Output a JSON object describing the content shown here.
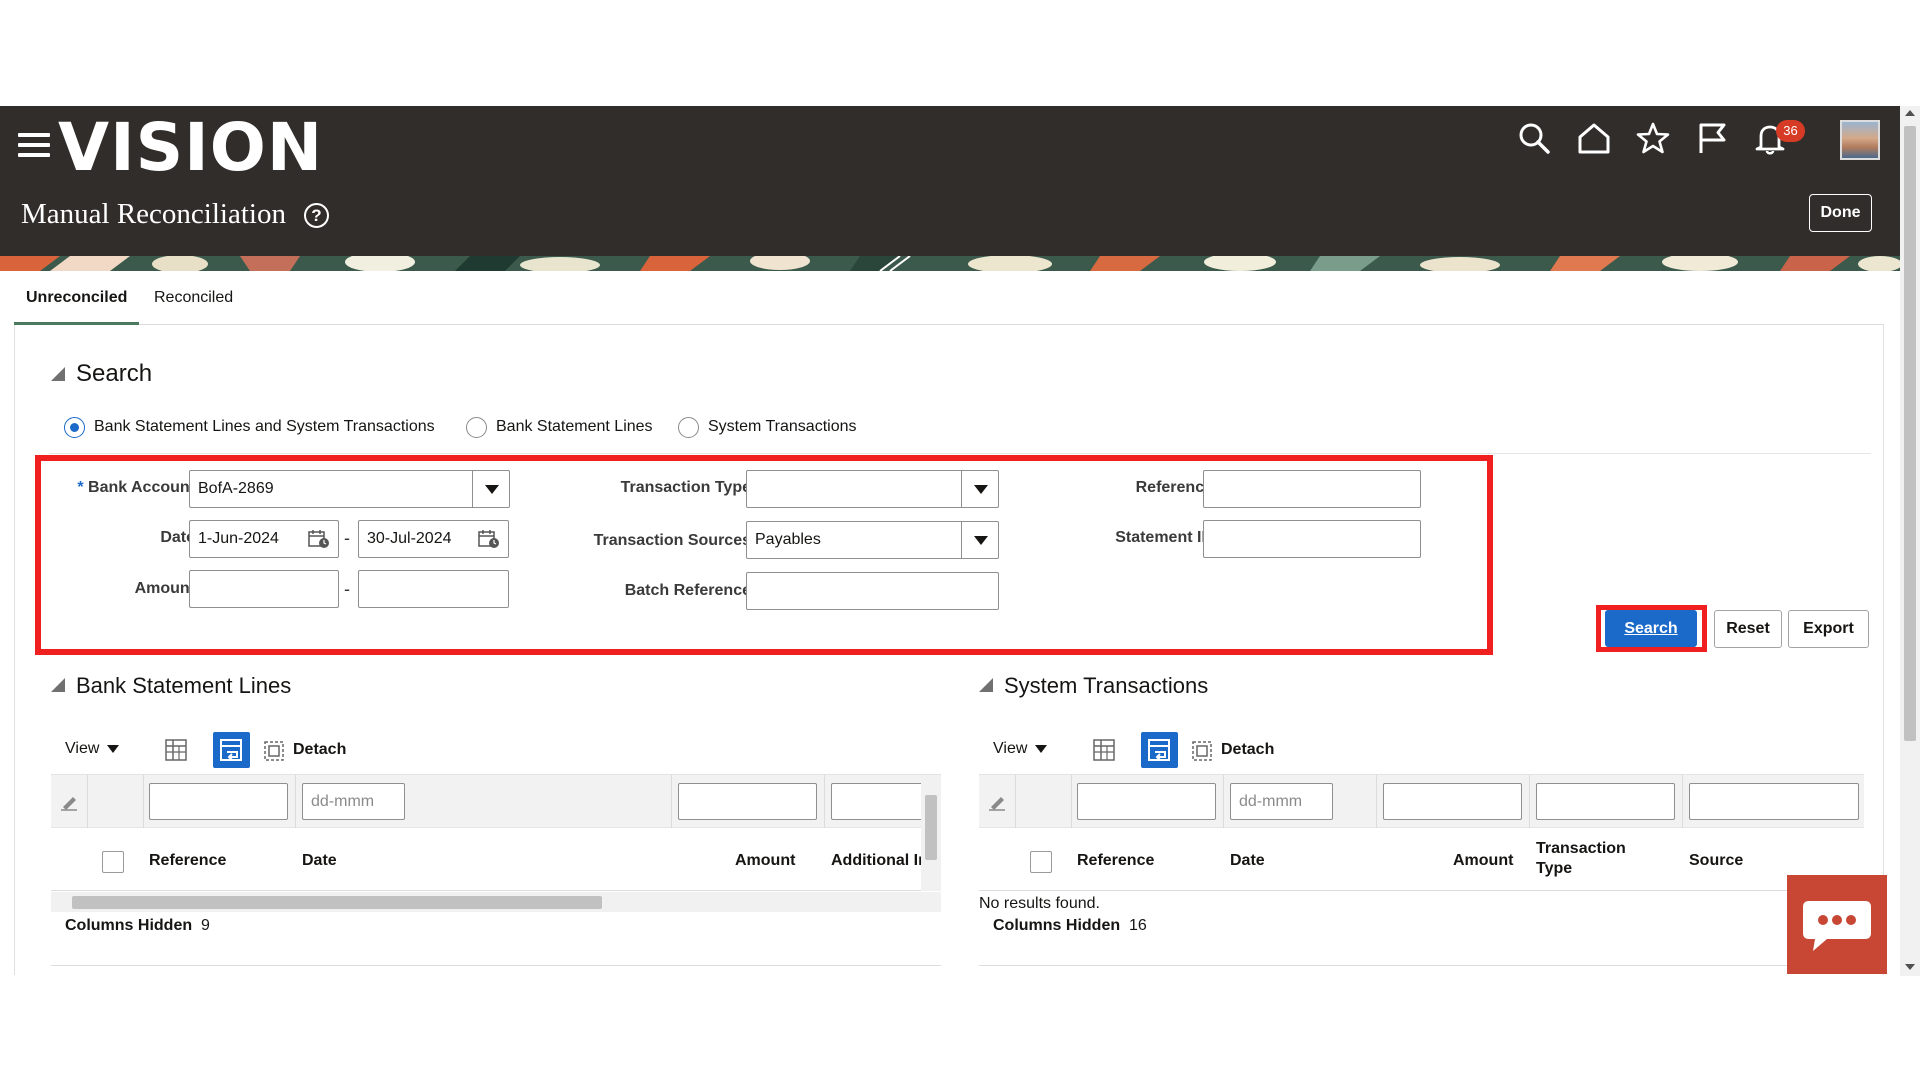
{
  "header": {
    "logo": "VISION",
    "title": "Manual Reconciliation",
    "help_glyph": "?",
    "notification_count": "36",
    "done_label": "Done"
  },
  "tabs": [
    {
      "label": "Unreconciled",
      "active": true
    },
    {
      "label": "Reconciled",
      "active": false
    }
  ],
  "search": {
    "title": "Search",
    "radios": [
      {
        "label": "Bank Statement Lines and System Transactions",
        "checked": true
      },
      {
        "label": "Bank Statement Lines",
        "checked": false
      },
      {
        "label": "System Transactions",
        "checked": false
      }
    ],
    "fields": {
      "bank_account": {
        "label": "Bank Account",
        "value": "BofA-2869",
        "required_mark": "*"
      },
      "date": {
        "label": "Date",
        "from": "1-Jun-2024",
        "to": "30-Jul-2024"
      },
      "amount": {
        "label": "Amount",
        "from": "",
        "to": ""
      },
      "transaction_type": {
        "label": "Transaction Type",
        "value": ""
      },
      "transaction_sources": {
        "label": "Transaction Sources",
        "value": "Payables"
      },
      "batch_reference": {
        "label": "Batch Reference",
        "value": ""
      },
      "reference": {
        "label": "Reference",
        "value": ""
      },
      "statement_id": {
        "label": "Statement ID",
        "value": ""
      },
      "range_separator": "-"
    },
    "buttons": {
      "search": "Search",
      "reset": "Reset",
      "export": "Export"
    }
  },
  "bank_lines": {
    "title": "Bank Statement Lines",
    "view_label": "View",
    "detach_label": "Detach",
    "date_filter_placeholder": "dd-mmm",
    "columns": [
      "Reference",
      "Date",
      "Amount",
      "Additional In"
    ],
    "columns_hidden_label": "Columns Hidden",
    "columns_hidden_count": "9"
  },
  "system_transactions": {
    "title": "System Transactions",
    "view_label": "View",
    "detach_label": "Detach",
    "date_filter_placeholder": "dd-mmm",
    "columns": [
      "Reference",
      "Date",
      "Amount",
      "Transaction Type",
      "Source"
    ],
    "no_results": "No results found.",
    "columns_hidden_label": "Columns Hidden",
    "columns_hidden_count": "16"
  },
  "colors": {
    "header_bg": "#312d2a",
    "accent_blue": "#1b6ac9",
    "highlight_red": "#f02020",
    "chat_red": "#c74634",
    "tab_underline": "#4d7a5e"
  },
  "icons": [
    "hamburger-icon",
    "search-icon",
    "home-icon",
    "star-icon",
    "flag-icon",
    "bell-icon",
    "help-icon",
    "calendar-icon",
    "freeze-icon",
    "wrap-icon",
    "detach-icon",
    "clear-filter-icon",
    "chat-icon"
  ]
}
